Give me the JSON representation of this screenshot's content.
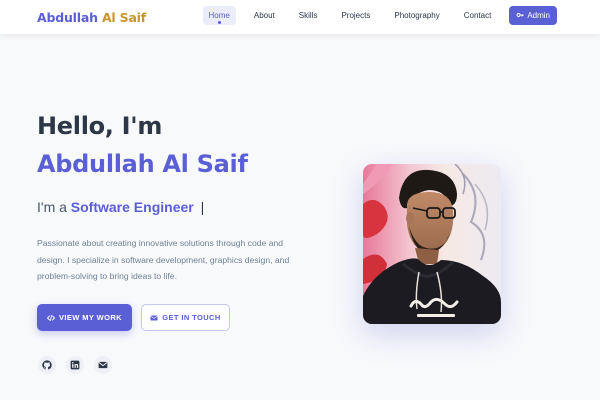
{
  "brand": {
    "first": "Abdullah",
    "last": "Al Saif"
  },
  "nav": {
    "items": [
      {
        "label": "Home"
      },
      {
        "label": "About"
      },
      {
        "label": "Skills"
      },
      {
        "label": "Projects"
      },
      {
        "label": "Photography"
      },
      {
        "label": "Contact"
      }
    ],
    "admin_label": "Admin"
  },
  "hero": {
    "greeting": "Hello, I'm",
    "name": "Abdullah Al Saif",
    "role_prefix": "I'm a",
    "role": "Software Engineer",
    "cursor": "|",
    "description": "Passionate about creating innovative solutions through code and design. I specialize in software development, graphics design, and problem-solving to bring ideas to life.",
    "primary_button": "VIEW MY WORK",
    "secondary_button": "GET IN TOUCH"
  },
  "social": [
    {
      "icon": "github-icon"
    },
    {
      "icon": "linkedin-icon"
    },
    {
      "icon": "envelope-icon"
    }
  ],
  "profile_image": {
    "shirt_text": "Shirt logo"
  },
  "colors": {
    "accent": "#5a5fd6",
    "brand_last": "#c9962e",
    "heading": "#2d3748",
    "muted": "#718096"
  }
}
